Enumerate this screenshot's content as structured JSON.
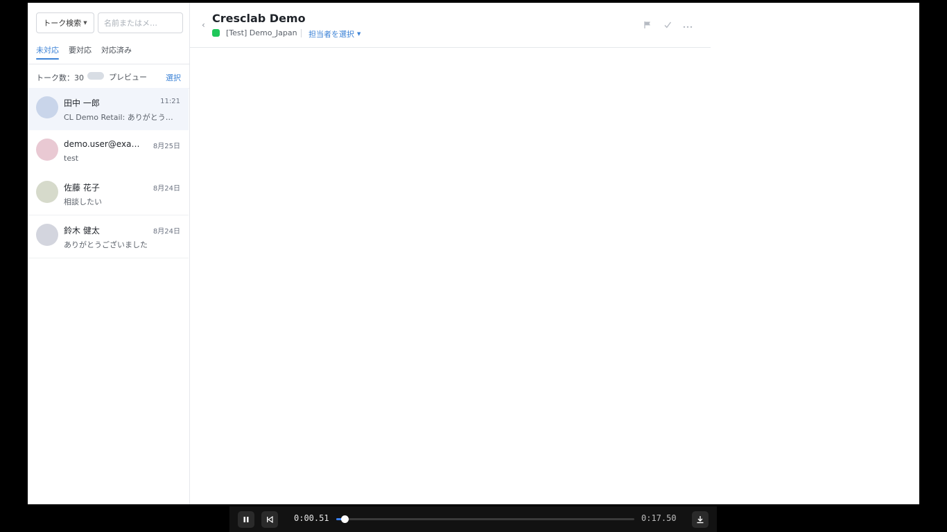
{
  "sidebar": {
    "search_select": "トーク検索",
    "search_placeholder": "名前またはメ…",
    "tabs": [
      {
        "label": "未対応",
        "active": true
      },
      {
        "label": "要対応",
        "active": false
      },
      {
        "label": "対応済み",
        "active": false
      }
    ],
    "count_label": "トーク数：30",
    "preview_label": "プレビュー",
    "select_label": "選択",
    "chats": [
      {
        "name": "田中 一郎",
        "time": "11:21",
        "snippet": "CL Demo Retail: ありがとうございます",
        "avatar_color": "#c9d5ea",
        "selected": true
      },
      {
        "name": "demo.user@example.com",
        "time": "8月25日",
        "snippet": "test",
        "avatar_color": "#e9c9d3",
        "selected": false
      },
      {
        "name": "佐藤 花子",
        "time": "8月24日",
        "snippet": "相談したい",
        "avatar_color": "#d6dacb",
        "selected": false
      },
      {
        "name": "鈴木 健太",
        "time": "8月24日",
        "snippet": "ありがとうございました",
        "avatar_color": "#d3d5de",
        "selected": false
      }
    ]
  },
  "header": {
    "title": "Cresclab Demo",
    "channel": "[Test] Demo_Japan",
    "channel_color": "#1fc75a",
    "assignee_label": "担当者を選択",
    "icons": [
      "flag-icon",
      "check-icon",
      "more-icon"
    ]
  },
  "player": {
    "current_time": "0:00.51",
    "total_time": "0:17.50",
    "progress": 0.029
  },
  "colors": {
    "accent": "#3b82d6"
  }
}
